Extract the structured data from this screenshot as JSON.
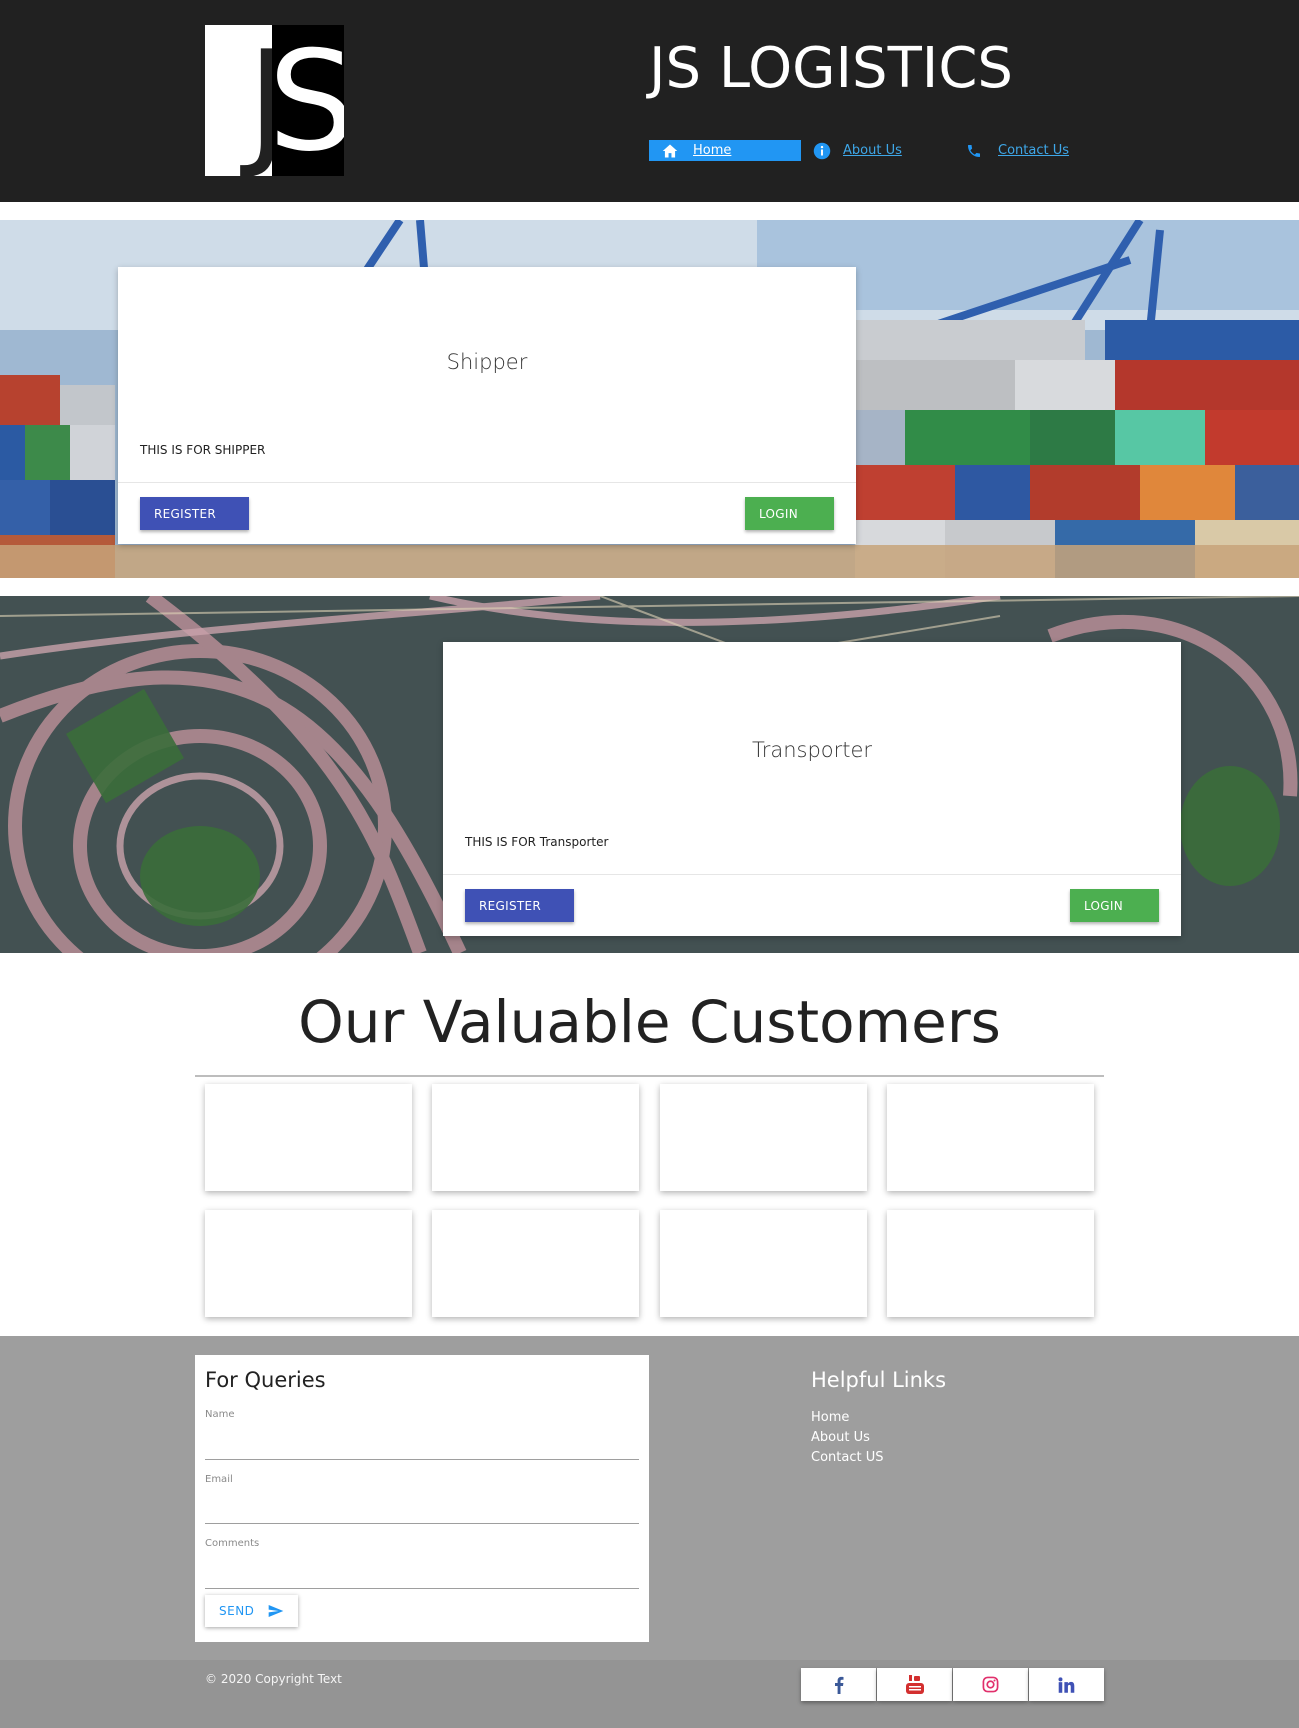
{
  "header": {
    "logo_left": "J",
    "logo_right": "S",
    "brand": "JS LOGISTICS",
    "nav": [
      {
        "label": "Home",
        "icon": "home-icon"
      },
      {
        "label": "About Us",
        "icon": "info-icon"
      },
      {
        "label": "Contact Us",
        "icon": "phone-icon"
      }
    ]
  },
  "cards": [
    {
      "title": "Shipper",
      "text": "THIS IS FOR SHIPPER",
      "register": "REGISTER",
      "login": "LOGIN"
    },
    {
      "title": "Transporter",
      "text": "THIS IS FOR Transporter",
      "register": "REGISTER",
      "login": "LOGIN"
    }
  ],
  "customers": {
    "title": "Our Valuable Customers"
  },
  "footer": {
    "query_title": "For Queries",
    "fields": [
      {
        "label": "Name"
      },
      {
        "label": "Email"
      },
      {
        "label": "Comments"
      }
    ],
    "send_label": "SEND",
    "links_title": "Helpful Links",
    "links": [
      "Home",
      "About Us",
      "Contact US"
    ],
    "copyright": "© 2020 Copyright Text",
    "social": [
      "facebook-icon",
      "youtube-icon",
      "instagram-icon",
      "linkedin-icon"
    ]
  },
  "colors": {
    "header_bg": "#212121",
    "accent_blue": "#2196f3",
    "register": "#3f51b5",
    "login": "#4caf50",
    "footer_bg": "#9e9e9e"
  }
}
